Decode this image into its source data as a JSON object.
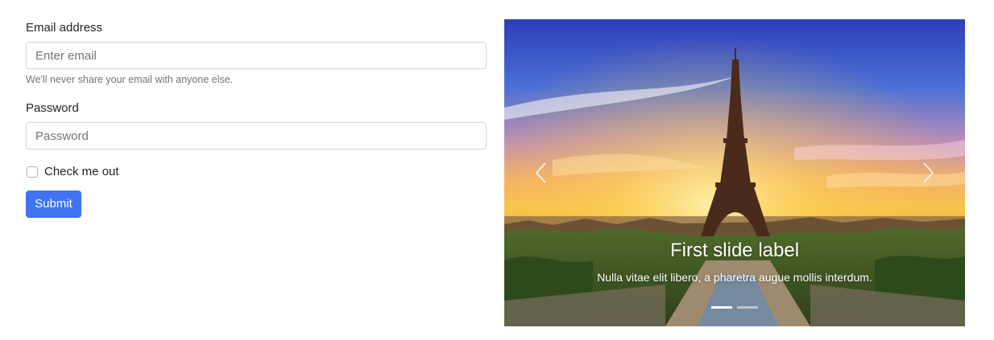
{
  "form": {
    "email": {
      "label": "Email address",
      "placeholder": "Enter email",
      "value": "",
      "help_text": "We'll never share your email with anyone else."
    },
    "password": {
      "label": "Password",
      "placeholder": "Password",
      "value": ""
    },
    "checkbox": {
      "label": "Check me out",
      "checked": false
    },
    "submit_label": "Submit"
  },
  "carousel": {
    "active_index": 0,
    "slides": [
      {
        "label": "First slide label",
        "text": "Nulla vitae elit libero, a pharetra augue mollis interdum."
      }
    ],
    "indicator_count": 2,
    "prev_icon": "chevron-left-icon",
    "next_icon": "chevron-right-icon"
  },
  "colors": {
    "primary": "#3e74f1",
    "muted_text": "#6c757d",
    "input_border": "#ced4da"
  }
}
